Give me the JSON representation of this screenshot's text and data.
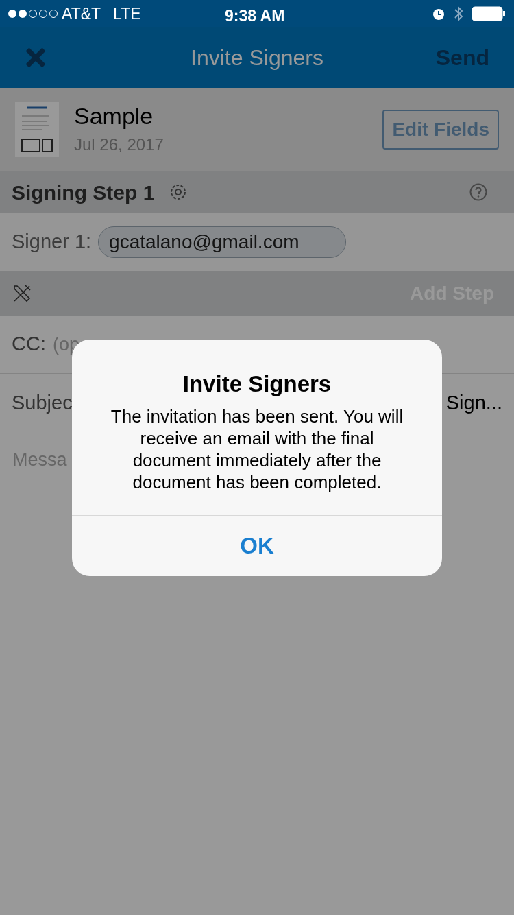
{
  "status_bar": {
    "carrier": "AT&T",
    "network": "LTE",
    "time": "9:38 AM"
  },
  "nav": {
    "title": "Invite Signers",
    "action": "Send"
  },
  "document": {
    "name": "Sample",
    "date": "Jul 26, 2017",
    "button": "Edit Fields"
  },
  "step": {
    "title": "Signing Step 1"
  },
  "signer": {
    "label": "Signer 1:",
    "email": "gcatalano@gmail.com"
  },
  "tools": {
    "action": "Add Step"
  },
  "cc": {
    "label": "CC:",
    "placeholder": "(op"
  },
  "subject": {
    "label": "Subjec",
    "value": "Sign..."
  },
  "message": {
    "placeholder": "Messa"
  },
  "dialog": {
    "title": "Invite Signers",
    "message": "The invitation has been sent. You will receive an email with the final document immediately after the document has been completed.",
    "button": "OK"
  }
}
